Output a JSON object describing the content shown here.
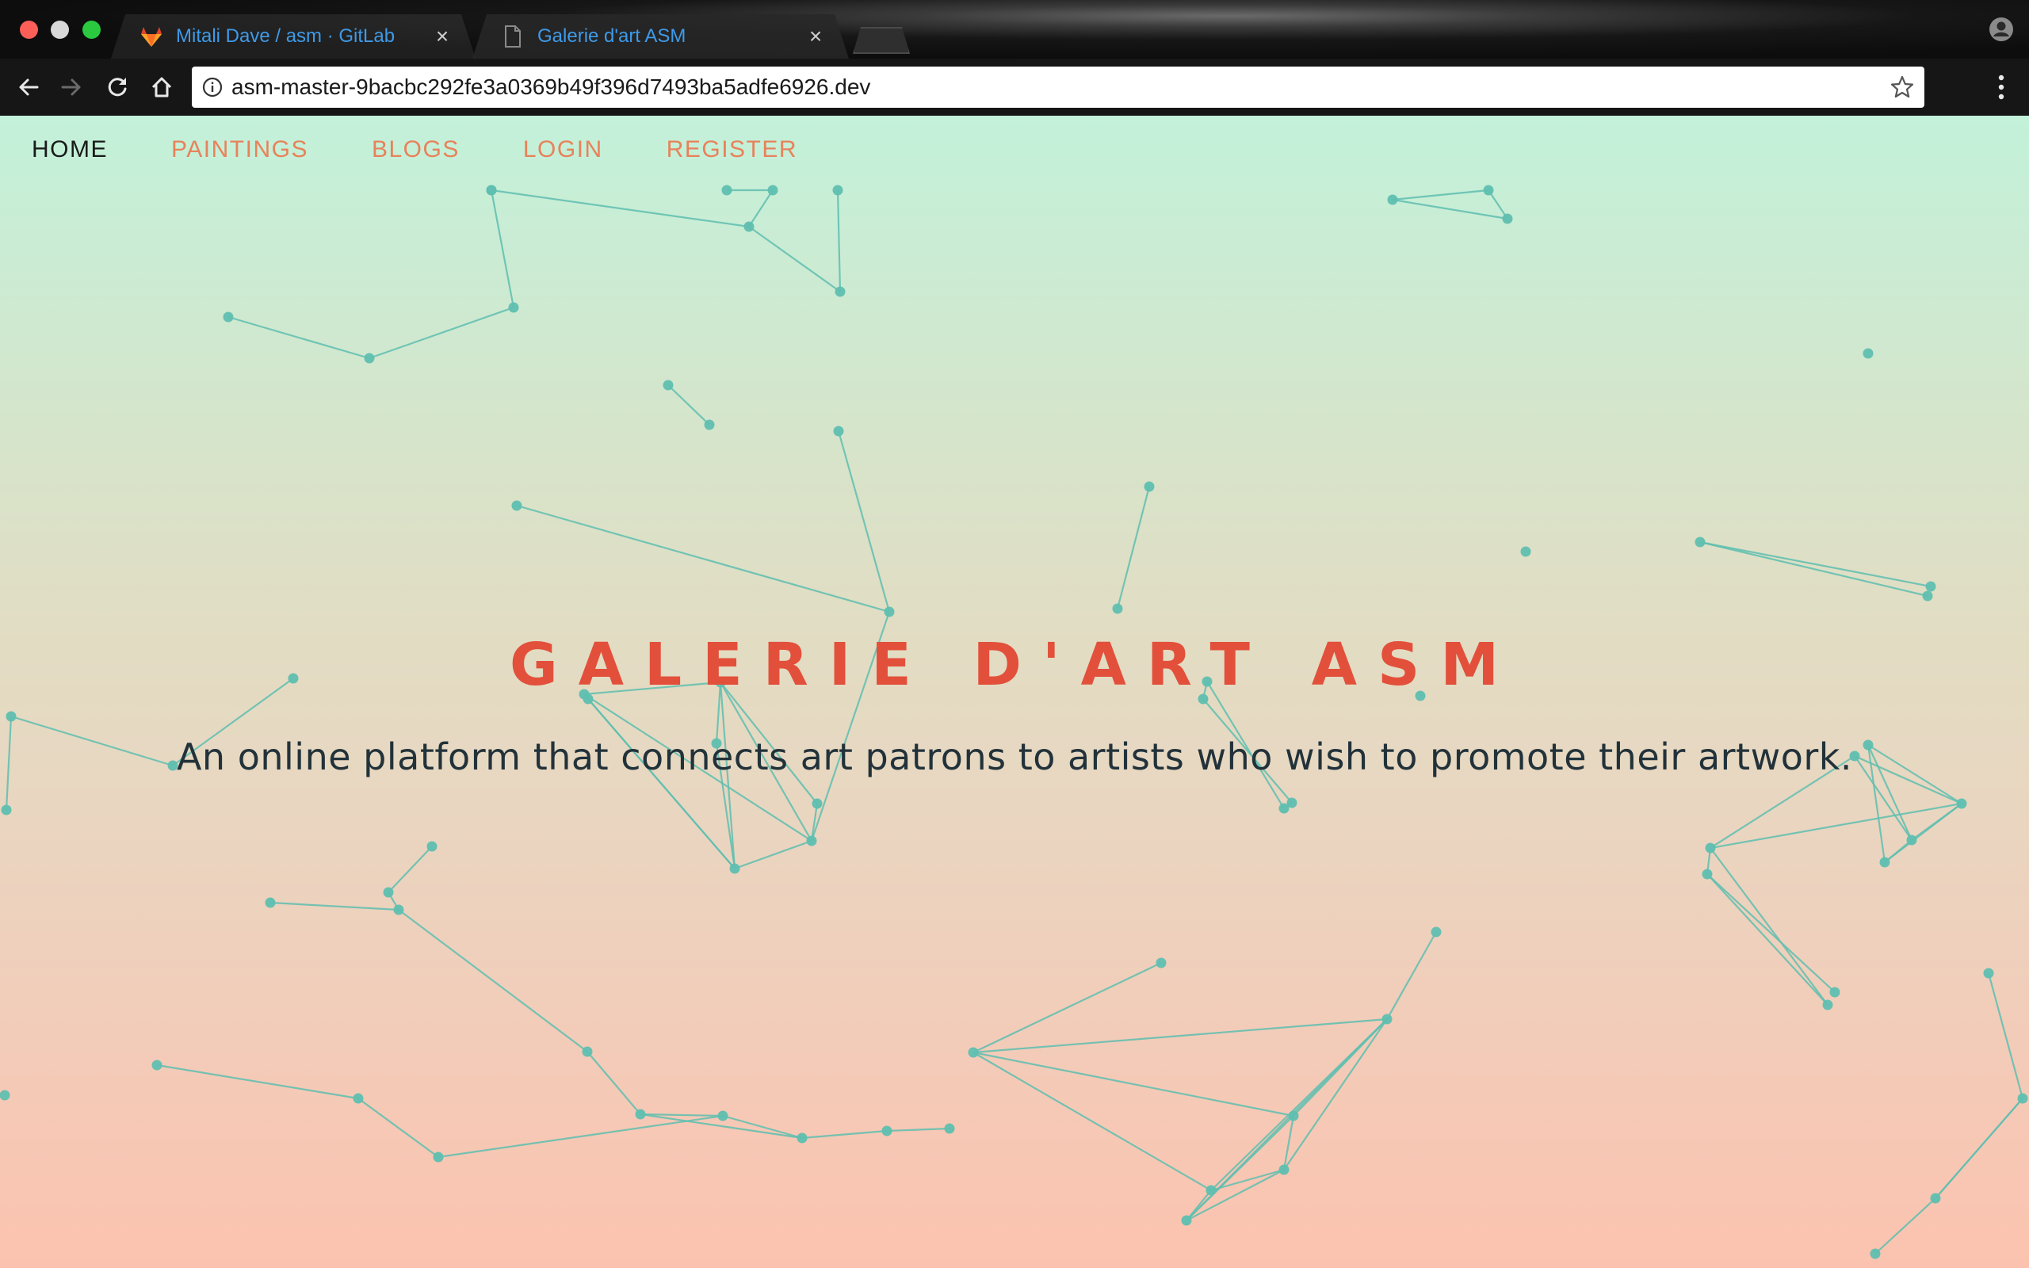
{
  "browser": {
    "tabs": [
      {
        "title": "Mitali Dave / asm · GitLab",
        "icon": "gitlab-icon",
        "active": false
      },
      {
        "title": "Galerie d'art ASM",
        "icon": "page-icon",
        "active": true
      }
    ],
    "close_glyph": "×",
    "url": "asm-master-9bacbc292fe3a0369b49f396d7493ba5adfe6926.dev",
    "colors": {
      "tab_text": "#3f9ae8",
      "chrome": "#161616"
    }
  },
  "site": {
    "nav": [
      {
        "label": "HOME",
        "active": true
      },
      {
        "label": "PAINTINGS",
        "active": false
      },
      {
        "label": "BLOGS",
        "active": false
      },
      {
        "label": "LOGIN",
        "active": false
      },
      {
        "label": "REGISTER",
        "active": false
      }
    ],
    "hero": {
      "title": "GALERIE D'ART ASM",
      "subtitle": "An online platform that connects art patrons to artists who wish to promote their artwork."
    },
    "colors": {
      "nav_link": "#e8825a",
      "nav_active": "#1a1a1a",
      "title": "#e2503b",
      "subtitle": "#22323a",
      "particles": "#5fbfb0",
      "gradient_top": "#c3f1da",
      "gradient_bottom": "#fbc3af"
    }
  }
}
